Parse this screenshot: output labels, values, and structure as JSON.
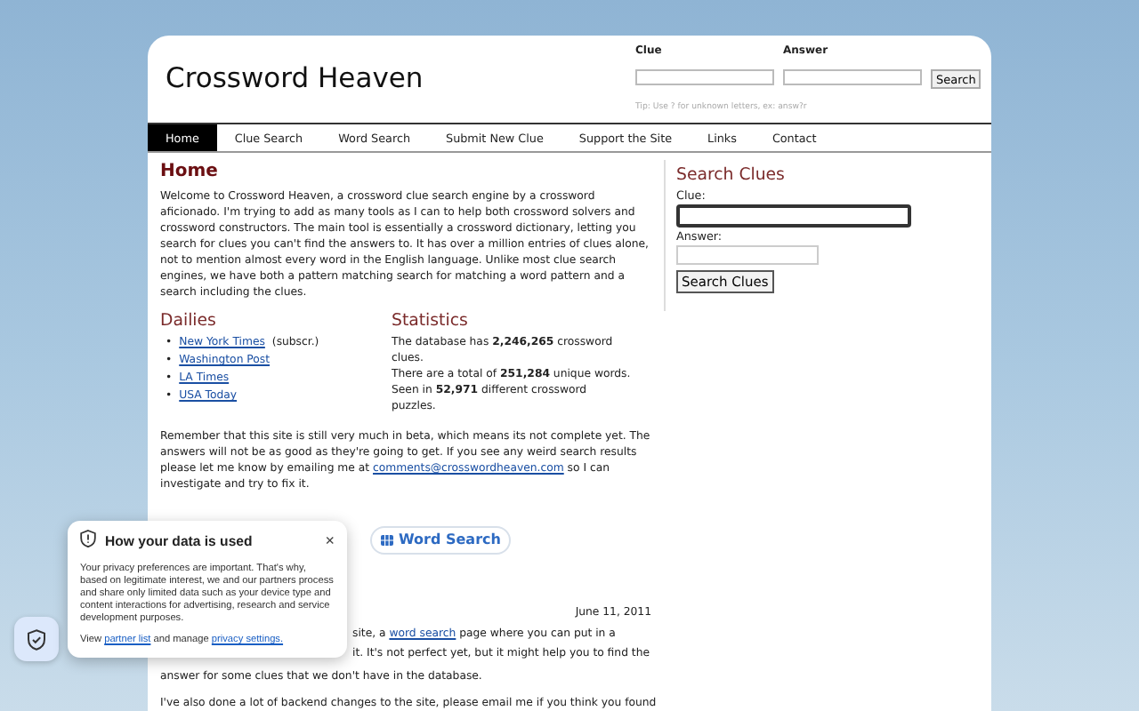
{
  "site": {
    "title": "Crossword Heaven"
  },
  "header_search": {
    "fields": [
      {
        "label": "Clue"
      },
      {
        "label": "Answer"
      }
    ],
    "button": "Search",
    "tip": "Tip: Use ? for unknown letters, ex: answ?r"
  },
  "nav": [
    {
      "label": "Home",
      "selected": true
    },
    {
      "label": "Clue Search",
      "selected": false
    },
    {
      "label": "Word Search",
      "selected": false
    },
    {
      "label": "Submit New Clue",
      "selected": false
    },
    {
      "label": "Support the Site",
      "selected": false
    },
    {
      "label": "Links",
      "selected": false
    },
    {
      "label": "Contact",
      "selected": false
    }
  ],
  "main": {
    "heading": "Home",
    "intro": "Welcome to Crossword Heaven, a crossword clue search engine by a crossword aficionado. I'm trying to add as many tools as I can to help both crossword solvers and crossword constructors. The main tool is essentially a crossword dictionary, letting you search for clues you can't find the answers to. It has over a million entries of clues alone, not to mention almost every word in the English language. Unlike most clue search engines, we have both a pattern matching search for matching a word pattern and a search including the clues.",
    "dailies": {
      "heading": "Dailies",
      "bullet": "•",
      "items": [
        {
          "link": "New York Times",
          "note": "(subscr.)"
        },
        {
          "link": "Washington Post"
        },
        {
          "link": "LA Times"
        },
        {
          "link": "USA Today"
        }
      ]
    },
    "statistics": {
      "heading": "Statistics",
      "lines": [
        "The database has **2,246,265** crossword clues.",
        "There are a total of **251,284** unique words.",
        "Seen in **52,971** different crossword puzzles."
      ]
    },
    "notice": {
      "before": "Remember that this site is still very much in beta, which means its not complete yet. The answers will not be as good as they're going to get. If you see any weird search results please let me know by emailing me at",
      "link": "comments@crosswordheaven.com",
      "after": "so I can investigate and try to fix it."
    },
    "share_button": "Word Search",
    "news": {
      "date": "June 11, 2011",
      "lines": [
        {
          "before": "site, a",
          "link": "word search",
          "after": "page where you can put in a"
        },
        {
          "before": "it. It's not perfect yet, but it might help you to find the"
        },
        {
          "before": "answer for some clues that we don't have in the database."
        },
        {
          "before": "I've also done a lot of backend changes to the site, please email me if you think you found"
        }
      ]
    }
  },
  "sidebar": {
    "heading": "Search Clues",
    "fields": [
      {
        "label": "Clue:",
        "focused": true
      },
      {
        "label": "Answer:",
        "focused": false
      }
    ],
    "button": "Search Clues"
  },
  "consent": {
    "title": "How your data is used",
    "close": "×",
    "body": "Your privacy preferences are important. That's why, based on legitimate interest, we and our partners process and share only limited data such as your device type and content interactions for advertising, research and service development purposes.",
    "footer": {
      "before": "View",
      "link1": "partner list",
      "middle": "and manage",
      "link2": "privacy settings."
    }
  }
}
